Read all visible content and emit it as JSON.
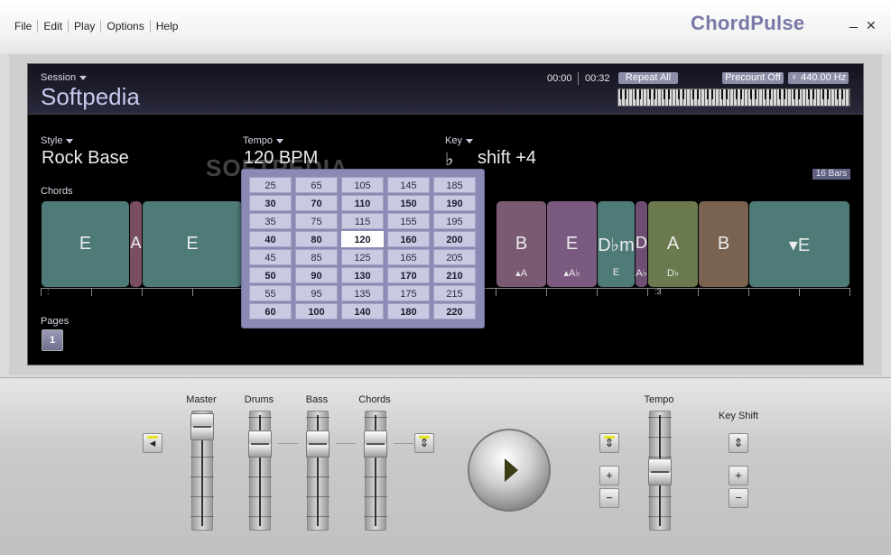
{
  "app": {
    "title": "ChordPulse"
  },
  "menu": [
    "File",
    "Edit",
    "Play",
    "Options",
    "Help"
  ],
  "window_controls": {
    "minimize": "_",
    "close": "✕"
  },
  "session": {
    "label": "Session",
    "name": "Softpedia",
    "time_elapsed": "00:00",
    "time_total": "00:32",
    "repeat": "Repeat All",
    "precount": "Precount Off",
    "tuning": "♀ 440.00 Hz"
  },
  "style": {
    "label": "Style",
    "value": "Rock Base"
  },
  "tempo": {
    "label": "Tempo",
    "value": "120 BPM"
  },
  "key": {
    "label": "Key",
    "symbol": "♭",
    "value": "shift +4"
  },
  "bars": "16 Bars",
  "chords_label": "Chords",
  "chords": [
    {
      "name": "E",
      "sub": "",
      "color": "#4e7a78"
    },
    {
      "name": "A",
      "sub": "",
      "color": "#7a4e62"
    },
    {
      "name": "E",
      "sub": "",
      "color": "#4e7a78"
    },
    {
      "name": "B",
      "sub": "▴A",
      "color": "#7a5a72"
    },
    {
      "name": "E",
      "sub": "▴A♭",
      "color": "#7a5a80"
    },
    {
      "name": "D♭m",
      "sub": "E",
      "color": "#4e7a78"
    },
    {
      "name": "D",
      "sub": "A♭",
      "color": "#6e4e72"
    },
    {
      "name": "A",
      "sub": "D♭",
      "color": "#6a7a4e"
    },
    {
      "name": "B",
      "sub": "",
      "color": "#7a6250"
    },
    {
      "name": "▾E",
      "sub": "",
      "color": "#4e7a78"
    }
  ],
  "timeline_marks": [
    ":",
    ":3"
  ],
  "pages": {
    "label": "Pages",
    "current": "1"
  },
  "tempo_options": [
    [
      "25",
      "65",
      "105",
      "145",
      "185"
    ],
    [
      "30",
      "70",
      "110",
      "150",
      "190"
    ],
    [
      "35",
      "75",
      "115",
      "155",
      "195"
    ],
    [
      "40",
      "80",
      "120",
      "160",
      "200"
    ],
    [
      "45",
      "85",
      "125",
      "165",
      "205"
    ],
    [
      "50",
      "90",
      "130",
      "170",
      "210"
    ],
    [
      "55",
      "95",
      "135",
      "175",
      "215"
    ],
    [
      "60",
      "100",
      "140",
      "180",
      "220"
    ]
  ],
  "tempo_selected": "120",
  "watermark": "SOFTPEDIA",
  "mixer": {
    "master": "Master",
    "drums": "Drums",
    "bass": "Bass",
    "chords": "Chords",
    "tempo": "Tempo",
    "key_shift": "Key Shift",
    "plus": "+",
    "minus": "−",
    "reset": "⇕",
    "mute": "◂"
  }
}
